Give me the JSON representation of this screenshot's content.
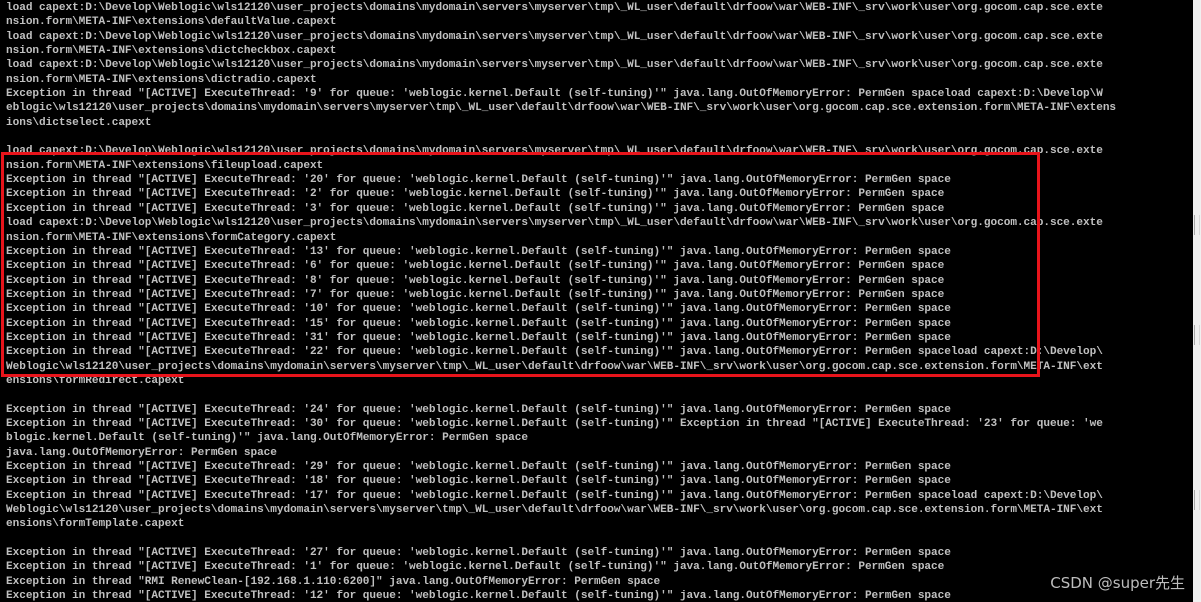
{
  "console": {
    "lines": [
      "load capext:D:\\Develop\\Weblogic\\wls12120\\user_projects\\domains\\mydomain\\servers\\myserver\\tmp\\_WL_user\\default\\drfoow\\war\\WEB-INF\\_srv\\work\\user\\org.gocom.cap.sce.exte",
      "nsion.form\\META-INF\\extensions\\defaultValue.capext",
      "load capext:D:\\Develop\\Weblogic\\wls12120\\user_projects\\domains\\mydomain\\servers\\myserver\\tmp\\_WL_user\\default\\drfoow\\war\\WEB-INF\\_srv\\work\\user\\org.gocom.cap.sce.exte",
      "nsion.form\\META-INF\\extensions\\dictcheckbox.capext",
      "load capext:D:\\Develop\\Weblogic\\wls12120\\user_projects\\domains\\mydomain\\servers\\myserver\\tmp\\_WL_user\\default\\drfoow\\war\\WEB-INF\\_srv\\work\\user\\org.gocom.cap.sce.exte",
      "nsion.form\\META-INF\\extensions\\dictradio.capext",
      "Exception in thread \"[ACTIVE] ExecuteThread: '9' for queue: 'weblogic.kernel.Default (self-tuning)'\" java.lang.OutOfMemoryError: PermGen spaceload capext:D:\\Develop\\W",
      "eblogic\\wls12120\\user_projects\\domains\\mydomain\\servers\\myserver\\tmp\\_WL_user\\default\\drfoow\\war\\WEB-INF\\_srv\\work\\user\\org.gocom.cap.sce.extension.form\\META-INF\\extens",
      "ions\\dictselect.capext",
      "",
      "load capext:D:\\Develop\\Weblogic\\wls12120\\user_projects\\domains\\mydomain\\servers\\myserver\\tmp\\_WL_user\\default\\drfoow\\war\\WEB-INF\\_srv\\work\\user\\org.gocom.cap.sce.exte",
      "nsion.form\\META-INF\\extensions\\fileupload.capext",
      "Exception in thread \"[ACTIVE] ExecuteThread: '20' for queue: 'weblogic.kernel.Default (self-tuning)'\" java.lang.OutOfMemoryError: PermGen space",
      "Exception in thread \"[ACTIVE] ExecuteThread: '2' for queue: 'weblogic.kernel.Default (self-tuning)'\" java.lang.OutOfMemoryError: PermGen space",
      "Exception in thread \"[ACTIVE] ExecuteThread: '3' for queue: 'weblogic.kernel.Default (self-tuning)'\" java.lang.OutOfMemoryError: PermGen space",
      "load capext:D:\\Develop\\Weblogic\\wls12120\\user_projects\\domains\\mydomain\\servers\\myserver\\tmp\\_WL_user\\default\\drfoow\\war\\WEB-INF\\_srv\\work\\user\\org.gocom.cap.sce.exte",
      "nsion.form\\META-INF\\extensions\\formCategory.capext",
      "Exception in thread \"[ACTIVE] ExecuteThread: '13' for queue: 'weblogic.kernel.Default (self-tuning)'\" java.lang.OutOfMemoryError: PermGen space",
      "Exception in thread \"[ACTIVE] ExecuteThread: '6' for queue: 'weblogic.kernel.Default (self-tuning)'\" java.lang.OutOfMemoryError: PermGen space",
      "Exception in thread \"[ACTIVE] ExecuteThread: '8' for queue: 'weblogic.kernel.Default (self-tuning)'\" java.lang.OutOfMemoryError: PermGen space",
      "Exception in thread \"[ACTIVE] ExecuteThread: '7' for queue: 'weblogic.kernel.Default (self-tuning)'\" java.lang.OutOfMemoryError: PermGen space",
      "Exception in thread \"[ACTIVE] ExecuteThread: '10' for queue: 'weblogic.kernel.Default (self-tuning)'\" java.lang.OutOfMemoryError: PermGen space",
      "Exception in thread \"[ACTIVE] ExecuteThread: '15' for queue: 'weblogic.kernel.Default (self-tuning)'\" java.lang.OutOfMemoryError: PermGen space",
      "Exception in thread \"[ACTIVE] ExecuteThread: '31' for queue: 'weblogic.kernel.Default (self-tuning)'\" java.lang.OutOfMemoryError: PermGen space",
      "Exception in thread \"[ACTIVE] ExecuteThread: '22' for queue: 'weblogic.kernel.Default (self-tuning)'\" java.lang.OutOfMemoryError: PermGen spaceload capext:D:\\Develop\\",
      "Weblogic\\wls12120\\user_projects\\domains\\mydomain\\servers\\myserver\\tmp\\_WL_user\\default\\drfoow\\war\\WEB-INF\\_srv\\work\\user\\org.gocom.cap.sce.extension.form\\META-INF\\ext",
      "ensions\\formRedirect.capext",
      "",
      "Exception in thread \"[ACTIVE] ExecuteThread: '24' for queue: 'weblogic.kernel.Default (self-tuning)'\" java.lang.OutOfMemoryError: PermGen space",
      "Exception in thread \"[ACTIVE] ExecuteThread: '30' for queue: 'weblogic.kernel.Default (self-tuning)'\" Exception in thread \"[ACTIVE] ExecuteThread: '23' for queue: 'we",
      "blogic.kernel.Default (self-tuning)'\" java.lang.OutOfMemoryError: PermGen space",
      "java.lang.OutOfMemoryError: PermGen space",
      "Exception in thread \"[ACTIVE] ExecuteThread: '29' for queue: 'weblogic.kernel.Default (self-tuning)'\" java.lang.OutOfMemoryError: PermGen space",
      "Exception in thread \"[ACTIVE] ExecuteThread: '18' for queue: 'weblogic.kernel.Default (self-tuning)'\" java.lang.OutOfMemoryError: PermGen space",
      "Exception in thread \"[ACTIVE] ExecuteThread: '17' for queue: 'weblogic.kernel.Default (self-tuning)'\" java.lang.OutOfMemoryError: PermGen spaceload capext:D:\\Develop\\",
      "Weblogic\\wls12120\\user_projects\\domains\\mydomain\\servers\\myserver\\tmp\\_WL_user\\default\\drfoow\\war\\WEB-INF\\_srv\\work\\user\\org.gocom.cap.sce.extension.form\\META-INF\\ext",
      "ensions\\formTemplate.capext",
      "",
      "Exception in thread \"[ACTIVE] ExecuteThread: '27' for queue: 'weblogic.kernel.Default (self-tuning)'\" java.lang.OutOfMemoryError: PermGen space",
      "Exception in thread \"[ACTIVE] ExecuteThread: '1' for queue: 'weblogic.kernel.Default (self-tuning)'\" java.lang.OutOfMemoryError: PermGen space",
      "Exception in thread \"RMI RenewClean-[192.168.1.110:6200]\" java.lang.OutOfMemoryError: PermGen space",
      "Exception in thread \"[ACTIVE] ExecuteThread: '12' for queue: 'weblogic.kernel.Default (self-tuning)'\" java.lang.OutOfMemoryError: PermGen space"
    ]
  },
  "watermark": "CSDN @super先生",
  "colors": {
    "background": "#000000",
    "text": "#c0c0c0",
    "highlight_border": "#e8141b"
  }
}
